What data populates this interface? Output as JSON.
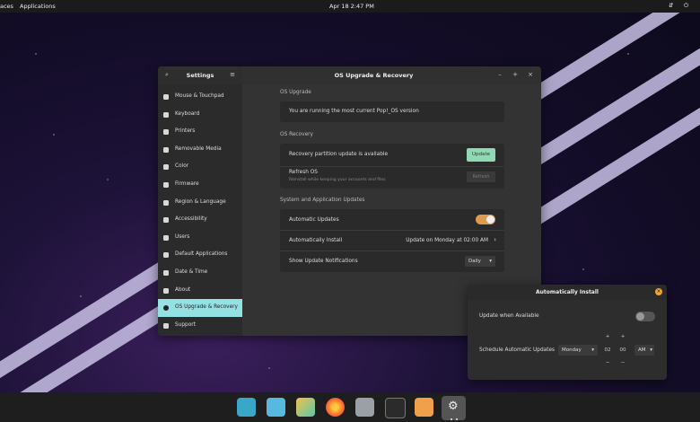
{
  "topbar": {
    "workspaces": "aces",
    "applications": "Applications",
    "datetime": "Apr 18  2:47 PM"
  },
  "settings": {
    "title": "Settings",
    "sidebar": [
      {
        "label": "Mouse & Touchpad",
        "icon": "mouse-icon"
      },
      {
        "label": "Keyboard",
        "icon": "keyboard-icon"
      },
      {
        "label": "Printers",
        "icon": "printer-icon"
      },
      {
        "label": "Removable Media",
        "icon": "media-icon"
      },
      {
        "label": "Color",
        "icon": "color-icon"
      },
      {
        "label": "Firmware",
        "icon": "firmware-icon"
      },
      {
        "label": "Region & Language",
        "icon": "globe-icon"
      },
      {
        "label": "Accessibility",
        "icon": "accessibility-icon"
      },
      {
        "label": "Users",
        "icon": "users-icon"
      },
      {
        "label": "Default Applications",
        "icon": "star-icon"
      },
      {
        "label": "Date & Time",
        "icon": "clock-icon"
      },
      {
        "label": "About",
        "icon": "info-icon"
      },
      {
        "label": "OS Upgrade & Recovery",
        "icon": "upgrade-icon",
        "selected": true
      },
      {
        "label": "Support",
        "icon": "help-icon"
      }
    ]
  },
  "main": {
    "title": "OS Upgrade & Recovery",
    "os_upgrade": {
      "heading": "OS Upgrade",
      "message": "You are running the most current Pop!_OS version"
    },
    "os_recovery": {
      "heading": "OS Recovery",
      "partition_text": "Recovery partition update is available",
      "update_button": "Update",
      "refresh_title": "Refresh OS",
      "refresh_sub": "Reinstall while keeping your accounts and files",
      "refresh_button": "Refresh"
    },
    "updates": {
      "heading": "System and Application Updates",
      "automatic_label": "Automatic Updates",
      "automatic_on": true,
      "install_label": "Automatically Install",
      "install_value": "Update on Monday at 02:00 AM",
      "notify_label": "Show Update Notifications",
      "notify_value": "Daily"
    }
  },
  "dialog": {
    "title": "Automatically Install",
    "when_available_label": "Update when Available",
    "when_available_on": false,
    "schedule_label": "Schedule Automatic Updates",
    "day": "Monday",
    "hour": "02",
    "minute": "00",
    "ampm": "AM",
    "plus": "+",
    "minus": "−"
  },
  "colors": {
    "accent": "#94e1e4",
    "update_button": "#8fd9b4",
    "toggle_on": "#e09a4e",
    "close": "#f2a43a"
  },
  "dock": [
    "screenshot-icon",
    "files-manager-icon",
    "app-grid-icon",
    "firefox-icon",
    "file-icon",
    "terminal-icon",
    "text-editor-icon",
    "settings-icon"
  ]
}
